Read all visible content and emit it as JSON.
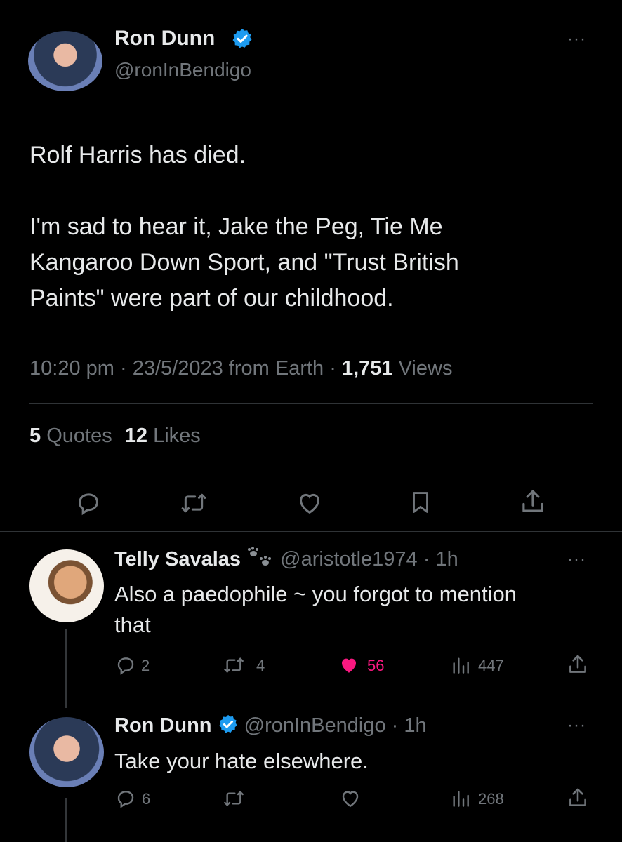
{
  "tweet": {
    "author_name": "Ron Dunn",
    "handle": "@ronInBendigo",
    "text_line1": "Rolf Harris has died.",
    "text_line2": "I'm sad to hear it, Jake the Peg, Tie Me",
    "text_line3": "Kangaroo Down Sport, and \"Trust British",
    "text_line4": "Paints\" were part of our childhood.",
    "time": "10:20 pm",
    "sep": "·",
    "date_source": "23/5/2023 from Earth",
    "views_count": "1,751",
    "views_label": "Views",
    "quotes_count": "5",
    "quotes_label": "Quotes",
    "likes_count": "12",
    "likes_label": "Likes"
  },
  "reply1": {
    "author_name": "Telly Savalas",
    "emoji_icon": "paw-prints-icon",
    "handle_time": "@aristotle1974 · 1h",
    "text_line1": "Also a paedophile ~ you forgot to mention",
    "text_line2": "that",
    "replies": "2",
    "retweets": "4",
    "likes": "56",
    "views": "447"
  },
  "reply2": {
    "author_name": "Ron Dunn",
    "handle_time": "@ronInBendigo · 1h",
    "text_line1": "Take your hate elsewhere.",
    "replies": "6",
    "views": "268"
  },
  "colors": {
    "background": "#000000",
    "text": "#e7e9ea",
    "muted": "#71767b",
    "verified": "#1d9bf0",
    "like_active": "#f91880",
    "divider": "#2f3336"
  }
}
